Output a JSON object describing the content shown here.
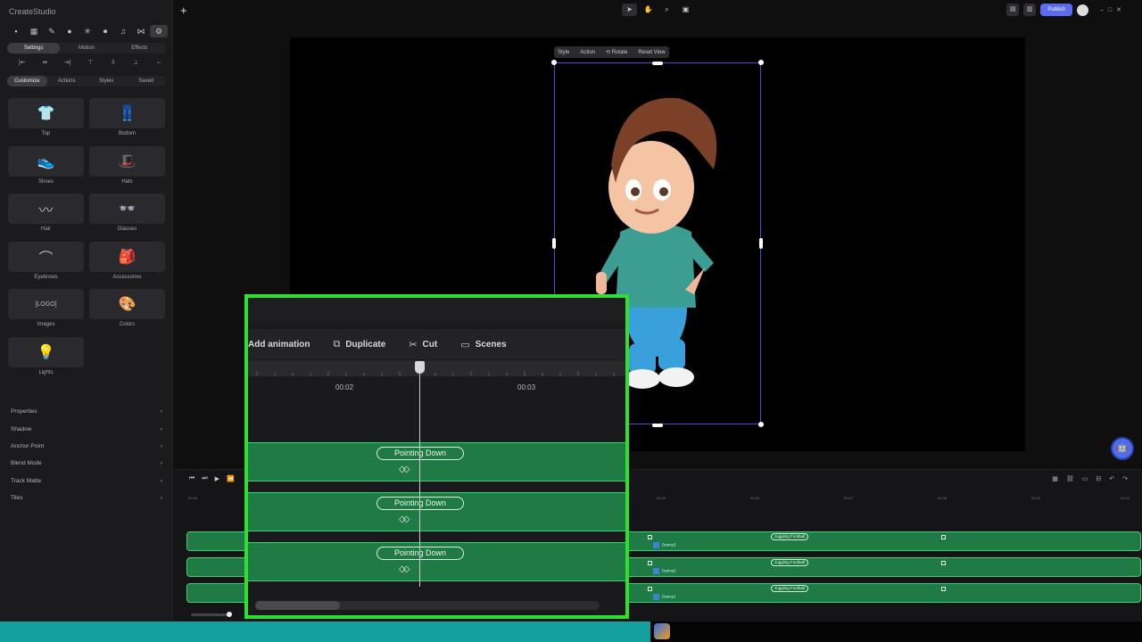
{
  "app": {
    "title": "CreateStudio"
  },
  "left_panel": {
    "toolbar_icons": [
      "folder-icon",
      "table-icon",
      "brush-icon",
      "circle-icon",
      "sparkle-icon",
      "record-icon",
      "music-icon",
      "bowtie-icon",
      "gear-icon"
    ],
    "main_tabs": [
      "Settings",
      "Motion",
      "Effects"
    ],
    "sub_tabs": [
      "Customize",
      "Actions",
      "Styles",
      "Saved"
    ],
    "assets": [
      {
        "label": "Top",
        "icon": "👕"
      },
      {
        "label": "Bottom",
        "icon": "👖"
      },
      {
        "label": "Shoes",
        "icon": "👟"
      },
      {
        "label": "Hats",
        "icon": "🎩"
      },
      {
        "label": "Hair",
        "icon": "〰"
      },
      {
        "label": "Glasses",
        "icon": "👓"
      },
      {
        "label": "Eyebrows",
        "icon": "⌒"
      },
      {
        "label": "Accessories",
        "icon": "🎒"
      },
      {
        "label": "Images",
        "icon": "[LOGO]"
      },
      {
        "label": "Colors",
        "icon": "🎨"
      },
      {
        "label": "Lights",
        "icon": "💡"
      }
    ],
    "properties": [
      "Properties",
      "Shadow",
      "Anchor Point",
      "Blend Mode",
      "Track Matte",
      "Tiles"
    ]
  },
  "topbar": {
    "publish": "Publish"
  },
  "canvas_toolbar": [
    "Style",
    "Action",
    "Rotate",
    "Reset View"
  ],
  "timeline": {
    "ruler": [
      "00:00",
      "00:05",
      "00:06",
      "00:07",
      "00:08",
      "00:09",
      "00:10"
    ],
    "tracks": [
      {
        "layer": "Danny3",
        "clip": "Juggling Football"
      },
      {
        "layer": "Danny2",
        "clip": "Juggling Football"
      },
      {
        "layer": "Danny1",
        "clip": "Juggling Football"
      }
    ]
  },
  "zoom_overlay": {
    "menu": [
      {
        "label": "Add animation",
        "icon": ""
      },
      {
        "label": "Duplicate",
        "icon": "⧉"
      },
      {
        "label": "Cut",
        "icon": "✂"
      },
      {
        "label": "Scenes",
        "icon": "▭"
      }
    ],
    "times": [
      "00:02",
      "00:03"
    ],
    "clips": [
      "Pointing Down",
      "Pointing Down",
      "Pointing Down"
    ]
  }
}
